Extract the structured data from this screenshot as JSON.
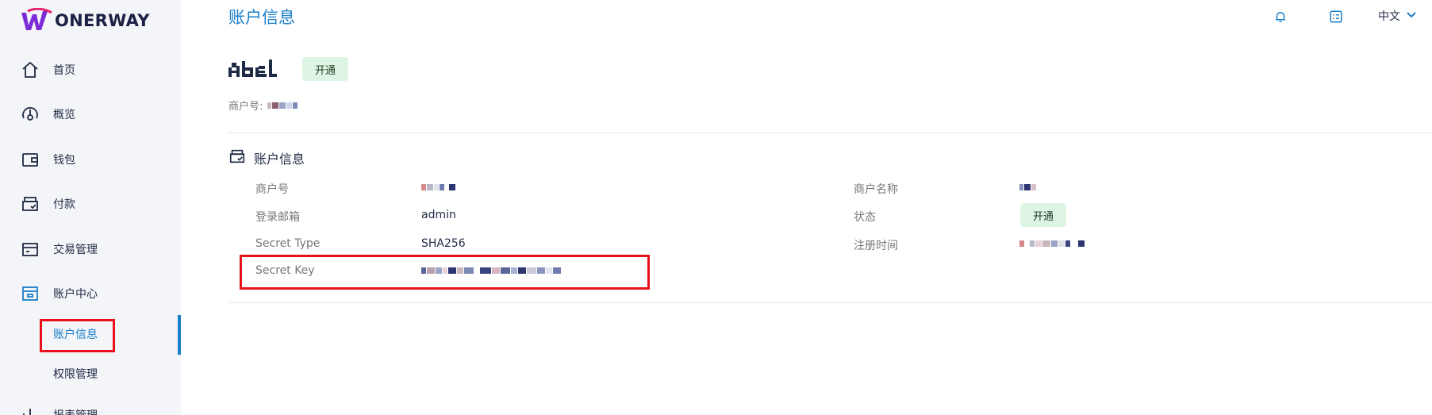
{
  "brand": {
    "name": "ONERWAY",
    "accent": "#1a7fc9",
    "logo_color": "#7a2bd6"
  },
  "sidebar": {
    "items": [
      {
        "label": "首页",
        "icon": "home-icon"
      },
      {
        "label": "概览",
        "icon": "dashboard-icon"
      },
      {
        "label": "钱包",
        "icon": "wallet-icon"
      },
      {
        "label": "付款",
        "icon": "payment-icon"
      },
      {
        "label": "交易管理",
        "icon": "transactions-icon"
      },
      {
        "label": "账户中心",
        "icon": "account-center-icon"
      }
    ],
    "sub_items": [
      {
        "label": "账户信息",
        "active": true
      },
      {
        "label": "权限管理",
        "active": false
      }
    ],
    "partial_item": {
      "label": "报表管理",
      "icon": "report-icon"
    }
  },
  "header": {
    "title": "账户信息",
    "language": "中文",
    "icons": [
      "bell-icon",
      "profile-card-icon",
      "chevron-down-icon"
    ]
  },
  "merchant": {
    "status_badge": "开通",
    "number_label": "商户号:"
  },
  "section": {
    "title": "账户信息",
    "fields_left": [
      {
        "label": "商户号",
        "value": ""
      },
      {
        "label": "登录邮箱",
        "value": "admin"
      },
      {
        "label": "Secret Type",
        "value": "SHA256"
      },
      {
        "label": "Secret Key",
        "value": ""
      }
    ],
    "fields_right": [
      {
        "label": "商户名称",
        "value": ""
      },
      {
        "label": "状态",
        "value": "开通"
      },
      {
        "label": "注册时间",
        "value": ""
      }
    ]
  },
  "colors": {
    "badge_bg": "#dff5e3",
    "highlight": "#e8101a",
    "sidebar_bg": "#f3f5f8"
  }
}
